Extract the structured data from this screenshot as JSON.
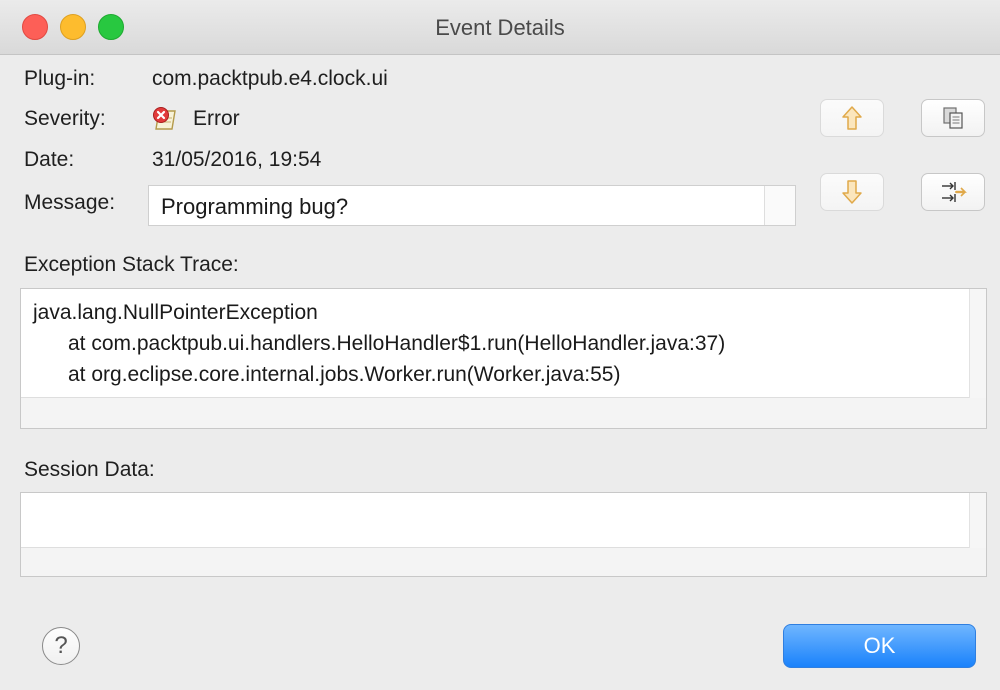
{
  "window": {
    "title": "Event Details"
  },
  "fields": {
    "plugin_label": "Plug-in:",
    "plugin_value": "com.packtpub.e4.clock.ui",
    "severity_label": "Severity:",
    "severity_value": "Error",
    "date_label": "Date:",
    "date_value": "31/05/2016, 19:54",
    "message_label": "Message:",
    "message_value": "Programming bug?"
  },
  "stack_trace": {
    "label": "Exception Stack Trace:",
    "lines": [
      "java.lang.NullPointerException",
      "      at com.packtpub.ui.handlers.HelloHandler$1.run(HelloHandler.java:37)",
      "      at org.eclipse.core.internal.jobs.Worker.run(Worker.java:55)"
    ]
  },
  "session": {
    "label": "Session Data:"
  },
  "buttons": {
    "help": "?",
    "ok": "OK"
  },
  "icons": {
    "severity": "error-icon",
    "previous": "arrow-up-icon",
    "next": "arrow-down-icon",
    "copy": "copy-icon",
    "filter": "filter-icon"
  },
  "colors": {
    "ok_button": "#1a82fb",
    "error_icon": "#e23b3b",
    "arrow_icon": "#e8b55a"
  }
}
